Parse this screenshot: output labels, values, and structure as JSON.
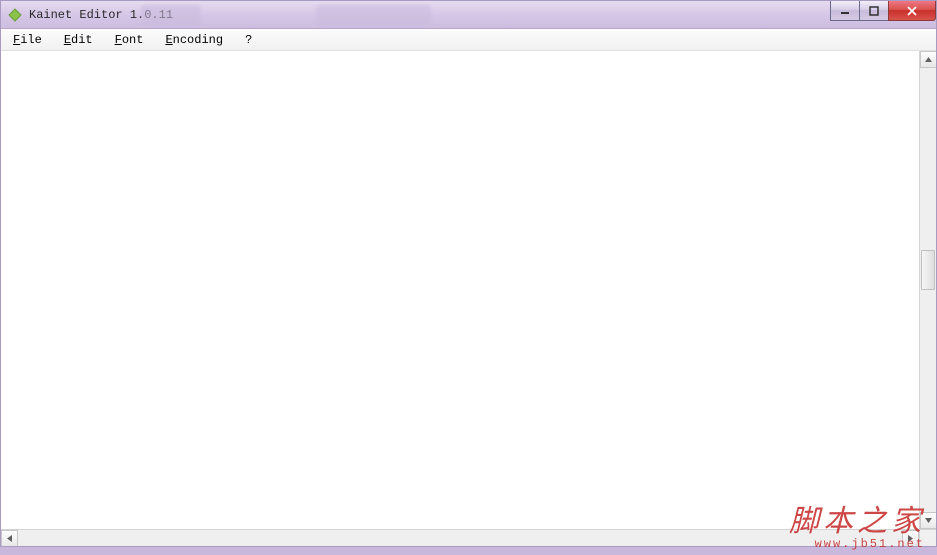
{
  "window": {
    "title": "Kainet Editor 1.0.11"
  },
  "menubar": {
    "items": [
      {
        "label": "File",
        "mnemonic": "F"
      },
      {
        "label": "Edit",
        "mnemonic": "E"
      },
      {
        "label": "Font",
        "mnemonic": "F"
      },
      {
        "label": "Encoding",
        "mnemonic": "E"
      },
      {
        "label": "?",
        "mnemonic": ""
      }
    ]
  },
  "editor": {
    "value": ""
  },
  "watermark": {
    "text": "脚本之家",
    "url": "www.jb51.net"
  }
}
